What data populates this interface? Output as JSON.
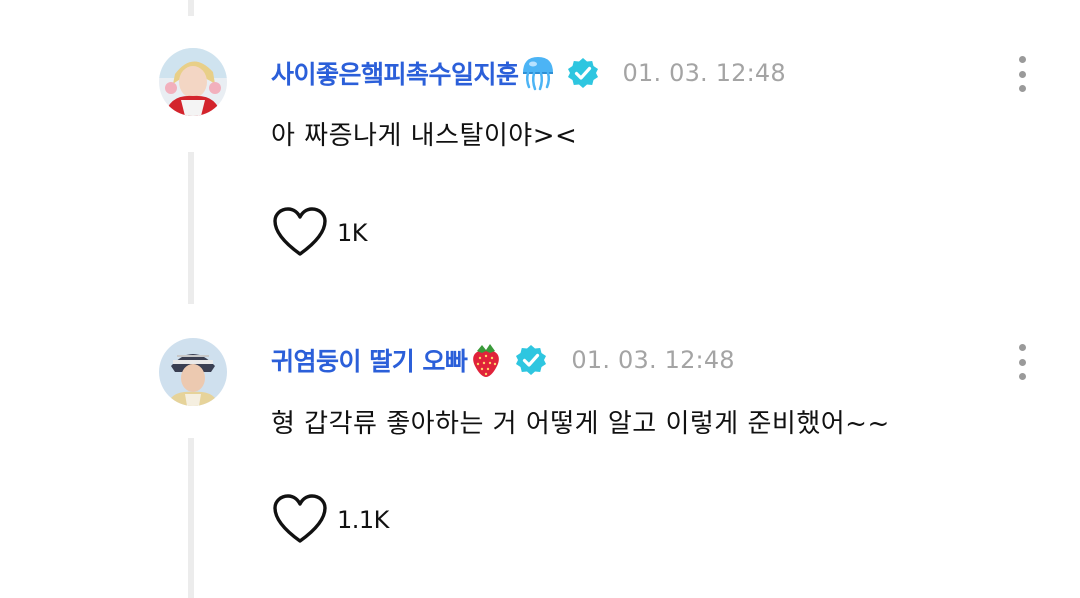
{
  "comments": [
    {
      "author": "사이좋은햌피촉수일지훈",
      "author_emoji": "jellyfish-emoji",
      "verified_icon": "verified-badge-icon",
      "timestamp": "01. 03. 12:48",
      "text": "아 짜증나게 내스탈이야><",
      "likes": "1K"
    },
    {
      "author": "귀염둥이 딸기 오빠",
      "author_emoji": "strawberry-emoji",
      "verified_icon": "verified-badge-icon",
      "timestamp": "01. 03. 12:48",
      "text": "형 갑각류 좋아하는 거 어떻게 알고 이렇게 준비했어~~",
      "likes": "1.1K"
    }
  ],
  "colors": {
    "author": "#2b5fd9",
    "verified": "#2ec6e0",
    "timestamp": "#a4a4a4",
    "thread_line": "#ececec",
    "more_dots": "#9a9a9a"
  }
}
